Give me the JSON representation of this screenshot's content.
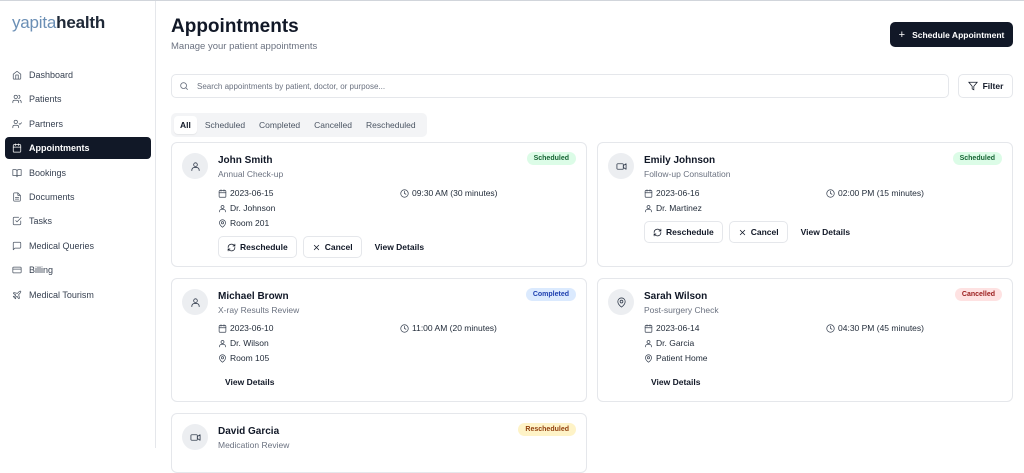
{
  "app": {
    "logo_part1": "yapita",
    "logo_part2": "health"
  },
  "sidebar": {
    "items": [
      {
        "label": "Dashboard",
        "icon": "home-icon"
      },
      {
        "label": "Patients",
        "icon": "users-icon"
      },
      {
        "label": "Partners",
        "icon": "user-check-icon"
      },
      {
        "label": "Appointments",
        "icon": "calendar-icon",
        "active": true
      },
      {
        "label": "Bookings",
        "icon": "book-icon"
      },
      {
        "label": "Documents",
        "icon": "file-icon"
      },
      {
        "label": "Tasks",
        "icon": "check-square-icon"
      },
      {
        "label": "Medical Queries",
        "icon": "message-icon"
      },
      {
        "label": "Billing",
        "icon": "credit-card-icon"
      },
      {
        "label": "Medical Tourism",
        "icon": "plane-icon"
      }
    ]
  },
  "header": {
    "title": "Appointments",
    "subtitle": "Manage your patient appointments",
    "schedule_button": "Schedule Appointment",
    "schedule_icon": "+"
  },
  "search": {
    "placeholder": "Search appointments by patient, doctor, or purpose..."
  },
  "filter": {
    "label": "Filter"
  },
  "tabs": [
    "All",
    "Scheduled",
    "Completed",
    "Cancelled",
    "Rescheduled"
  ],
  "actions": {
    "reschedule": "Reschedule",
    "cancel": "Cancel",
    "view": "View Details"
  },
  "appointments": [
    {
      "patient": "John Smith",
      "purpose": "Annual Check-up",
      "status": "Scheduled",
      "date": "2023-06-15",
      "time": "09:30 AM (30 minutes)",
      "doctor": "Dr. Johnson",
      "location": "Room 201",
      "type_icon": "user-icon"
    },
    {
      "patient": "Emily Johnson",
      "purpose": "Follow-up Consultation",
      "status": "Scheduled",
      "date": "2023-06-16",
      "time": "02:00 PM (15 minutes)",
      "doctor": "Dr. Martinez",
      "location": "",
      "type_icon": "video-icon"
    },
    {
      "patient": "Michael Brown",
      "purpose": "X-ray Results Review",
      "status": "Completed",
      "date": "2023-06-10",
      "time": "11:00 AM (20 minutes)",
      "doctor": "Dr. Wilson",
      "location": "Room 105",
      "type_icon": "user-icon"
    },
    {
      "patient": "Sarah Wilson",
      "purpose": "Post-surgery Check",
      "status": "Cancelled",
      "date": "2023-06-14",
      "time": "04:30 PM (45 minutes)",
      "doctor": "Dr. Garcia",
      "location": "Patient Home",
      "type_icon": "map-pin-icon"
    },
    {
      "patient": "David Garcia",
      "purpose": "Medication Review",
      "status": "Rescheduled",
      "type_icon": "video-icon"
    }
  ],
  "colors": {
    "primary": "#111827",
    "scheduled": "#166534",
    "completed": "#1e40af",
    "cancelled": "#991b1b",
    "rescheduled": "#92400e"
  }
}
